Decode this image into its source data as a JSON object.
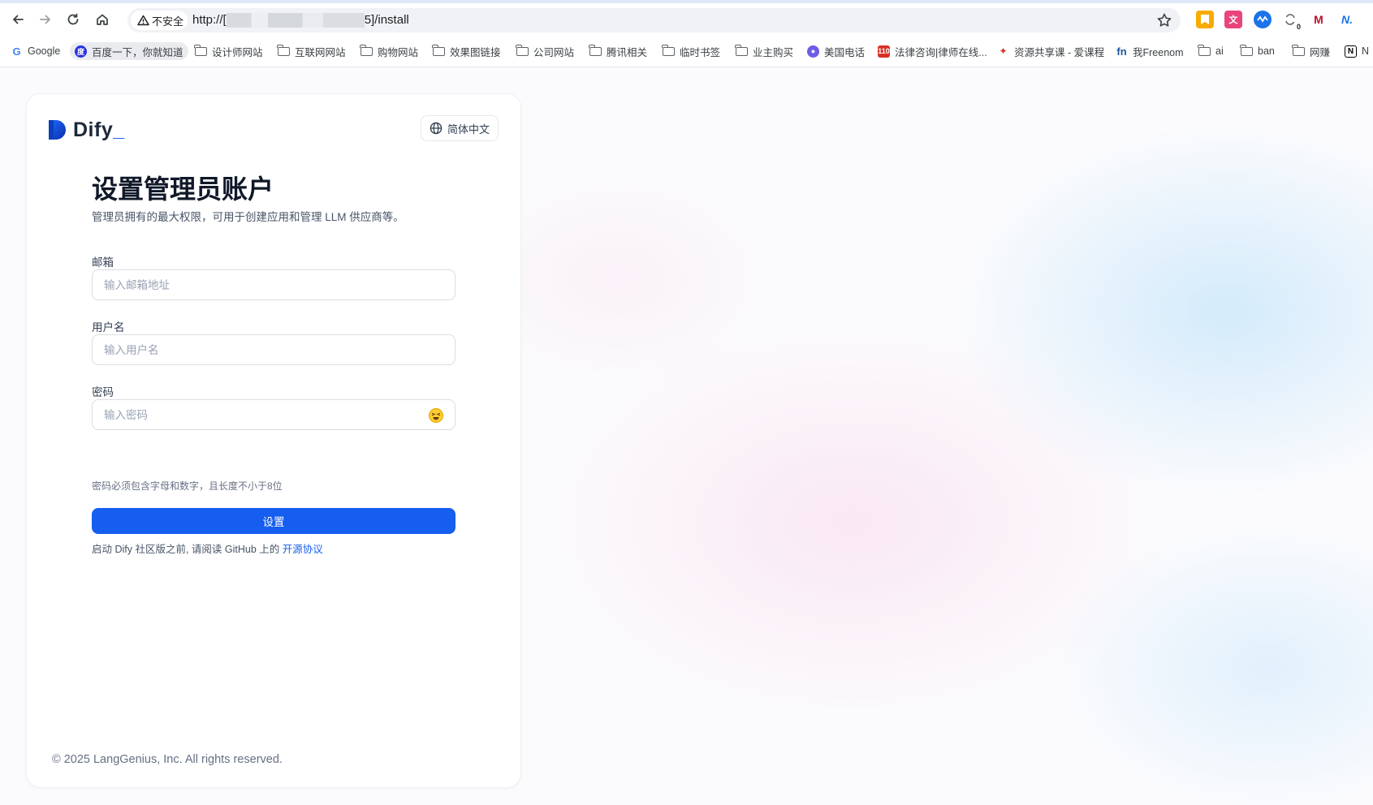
{
  "browser": {
    "security_label": "不安全",
    "url_prefix": "http://[",
    "url_suffix": "5]/install",
    "bookmarks": [
      {
        "label": "Google",
        "icon": "google-favicon"
      },
      {
        "label": "百度一下，你就知道",
        "icon": "baidu-favicon"
      },
      {
        "label": "设计师网站",
        "icon": "folder-icon"
      },
      {
        "label": "互联网网站",
        "icon": "folder-icon"
      },
      {
        "label": "购物网站",
        "icon": "folder-icon"
      },
      {
        "label": "效果图链接",
        "icon": "folder-icon"
      },
      {
        "label": "公司网站",
        "icon": "folder-icon"
      },
      {
        "label": "腾讯相关",
        "icon": "folder-icon"
      },
      {
        "label": "临时书签",
        "icon": "folder-icon"
      },
      {
        "label": "业主购买",
        "icon": "folder-icon"
      },
      {
        "label": "美国电话",
        "icon": "chat-favicon"
      },
      {
        "label": "法律咨询|律师在线...",
        "icon": "law-favicon"
      },
      {
        "label": "资源共享课 - 爱课程",
        "icon": "course-favicon"
      },
      {
        "label": "我Freenom",
        "icon": "freenom-favicon"
      },
      {
        "label": "ai",
        "icon": "folder-icon"
      },
      {
        "label": "ban",
        "icon": "folder-icon"
      },
      {
        "label": "网赚",
        "icon": "folder-icon"
      },
      {
        "label": "N",
        "icon": "notion-favicon"
      }
    ],
    "ext_badge": "0"
  },
  "app": {
    "logo_text": "Dify",
    "logo_dot": "_",
    "language_button": "简体中文"
  },
  "form": {
    "title": "设置管理员账户",
    "subtitle": "管理员拥有的最大权限，可用于创建应用和管理 LLM 供应商等。",
    "email_label": "邮箱",
    "email_placeholder": "输入邮箱地址",
    "username_label": "用户名",
    "username_placeholder": "输入用户名",
    "password_label": "密码",
    "password_placeholder": "输入密码",
    "password_hint": "密码必须包含字母和数字，且长度不小于8位",
    "submit_label": "设置",
    "license_prefix": "启动 Dify 社区版之前, 请阅读 GitHub 上的",
    "license_link": "开源协议"
  },
  "footer": {
    "copyright": "© 2025 LangGenius, Inc. All rights reserved."
  },
  "colors": {
    "accent": "#155eef",
    "card_bg": "#ffffff",
    "text_primary": "#101828"
  }
}
